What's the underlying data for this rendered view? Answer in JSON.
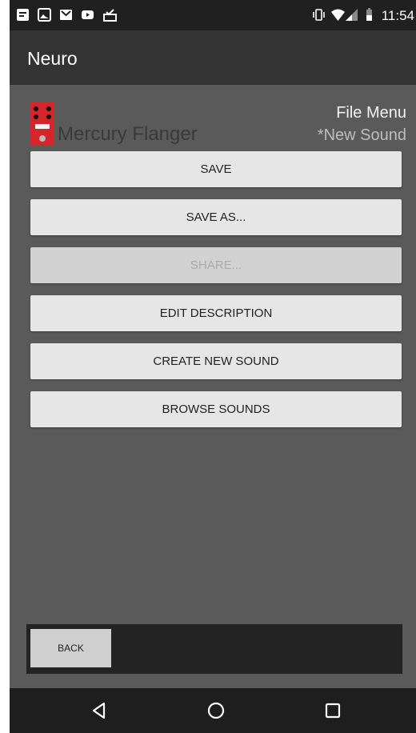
{
  "status_bar": {
    "time": "11:54",
    "left_icons": [
      "document-notification-icon",
      "image-notification-icon",
      "gmail-icon",
      "youtube-icon",
      "download-done-icon"
    ],
    "right_icons": [
      "vibrate-icon",
      "wifi-icon",
      "signal-icon",
      "battery-icon"
    ]
  },
  "app_bar": {
    "title": "Neuro"
  },
  "header": {
    "pedal_name": "Mercury Flanger",
    "menu_title": "File Menu",
    "sound_name": "*New Sound"
  },
  "menu": {
    "buttons": [
      {
        "label": "SAVE",
        "enabled": true
      },
      {
        "label": "SAVE AS...",
        "enabled": true
      },
      {
        "label": "SHARE...",
        "enabled": false
      },
      {
        "label": "EDIT DESCRIPTION",
        "enabled": true
      },
      {
        "label": "CREATE NEW SOUND",
        "enabled": true
      },
      {
        "label": "BROWSE SOUNDS",
        "enabled": true
      }
    ]
  },
  "footer": {
    "back_label": "BACK"
  },
  "nav_bar": {
    "icons": [
      "back-triangle-icon",
      "home-circle-icon",
      "recents-square-icon"
    ]
  },
  "colors": {
    "background": "#5a5a5a",
    "app_bar": "#333333",
    "status_bar": "#202020",
    "button": "#e6e6e6",
    "pedal": "#d4262a"
  }
}
